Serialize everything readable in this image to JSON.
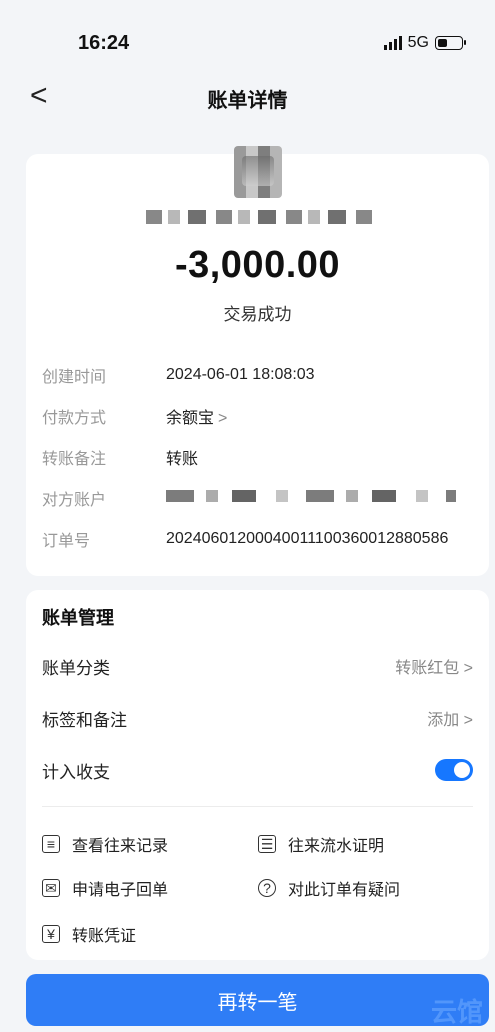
{
  "status_bar": {
    "time": "16:24",
    "network": "5G"
  },
  "header": {
    "back": "<",
    "title": "账单详情"
  },
  "transaction": {
    "amount": "-3,000.00",
    "status": "交易成功",
    "rows": [
      {
        "label": "创建时间",
        "value": "2024-06-01 18:08:03"
      },
      {
        "label": "付款方式",
        "value": "余额宝",
        "chevron": ">"
      },
      {
        "label": "转账备注",
        "value": "转账"
      },
      {
        "label": "对方账户",
        "value": ""
      },
      {
        "label": "订单号",
        "value": "20240601200040011100360012880586"
      }
    ]
  },
  "management": {
    "title": "账单管理",
    "category_label": "账单分类",
    "category_value": "转账红包 >",
    "tags_label": "标签和备注",
    "tags_value": "添加 >",
    "count_label": "计入收支",
    "count_enabled": true,
    "links": [
      {
        "label": "查看往来记录",
        "icon": "record-list-icon"
      },
      {
        "label": "往来流水证明",
        "icon": "statement-icon"
      },
      {
        "label": "申请电子回单",
        "icon": "mail-icon"
      },
      {
        "label": "对此订单有疑问",
        "icon": "question-icon"
      },
      {
        "label": "转账凭证",
        "icon": "yuan-voucher-icon"
      }
    ]
  },
  "primary_button": "再转一笔",
  "watermark": "云馆"
}
